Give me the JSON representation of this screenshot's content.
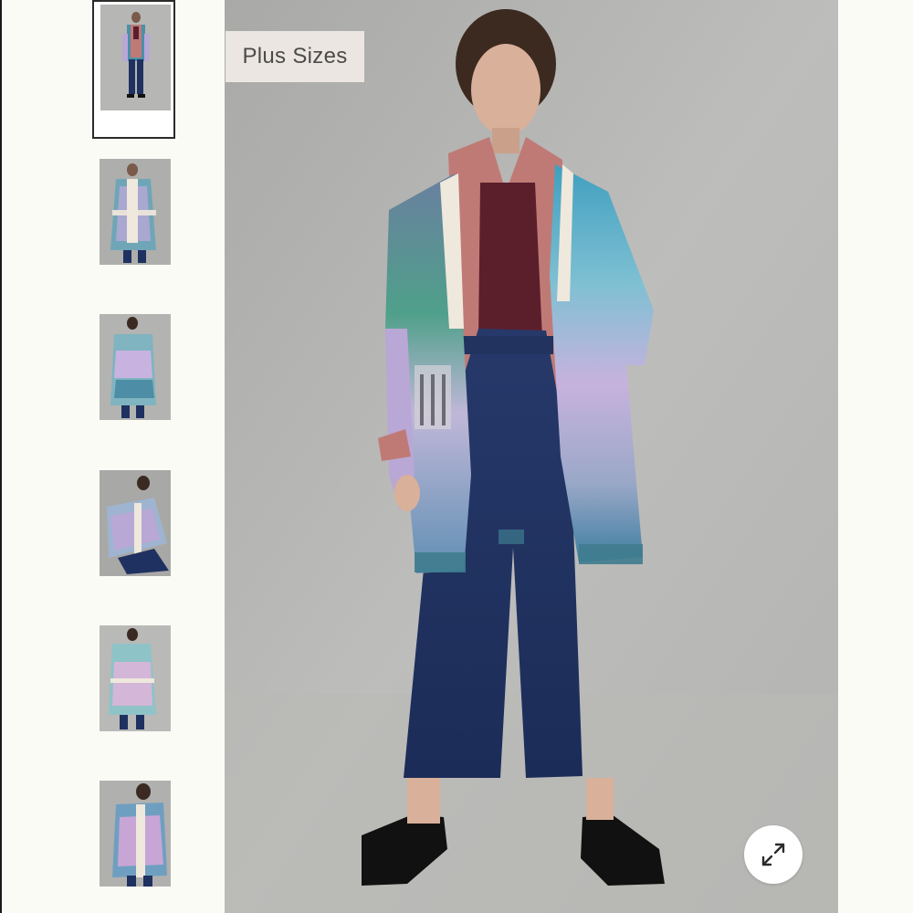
{
  "gallery": {
    "badge_label": "Plus Sizes",
    "thumbnails": [
      {
        "view": "front-standing",
        "selected": true
      },
      {
        "view": "front-belted"
      },
      {
        "view": "back"
      },
      {
        "view": "crouching"
      },
      {
        "view": "side-belted"
      },
      {
        "view": "front-belted-closeup"
      }
    ],
    "main_view": "front-standing",
    "expand_icon": "expand-arrows-icon"
  },
  "colors": {
    "page_bg": "#fbfbf6",
    "photo_bg": "#b4b4b2",
    "badge_bg": "#ebe6e1",
    "badge_text": "#4b4b4b",
    "selected_border": "#2b2b2b",
    "denim": "#1f3160",
    "cardigan_teal": "#3d8fa6",
    "cardigan_lilac": "#b9a7d6",
    "shirt_pink": "#c07a76",
    "top_burgundy": "#5b1f2c"
  }
}
